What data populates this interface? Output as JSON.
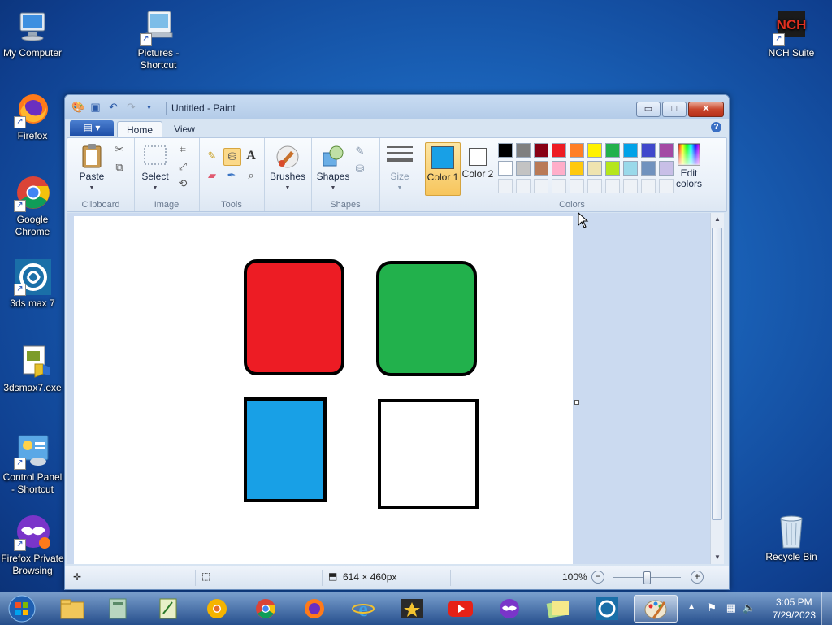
{
  "desktop": {
    "icons": [
      {
        "label": "My Computer",
        "icon": "computer-icon"
      },
      {
        "label": "Pictures - Shortcut",
        "icon": "pictures-shortcut-icon"
      },
      {
        "label": "NCH Suite",
        "icon": "nch-suite-icon"
      },
      {
        "label": "Firefox",
        "icon": "firefox-icon"
      },
      {
        "label": "Google Chrome",
        "icon": "chrome-icon"
      },
      {
        "label": "3ds max 7",
        "icon": "3ds-max-icon"
      },
      {
        "label": "3dsmax7.exe",
        "icon": "setup-exe-icon"
      },
      {
        "label": "Control Panel - Shortcut",
        "icon": "control-panel-icon"
      },
      {
        "label": "Firefox Private Browsing",
        "icon": "firefox-private-icon"
      },
      {
        "label": "Recycle Bin",
        "icon": "recycle-bin-icon"
      }
    ]
  },
  "window": {
    "title": "Untitled - Paint",
    "buttons": {
      "minimize": "▭",
      "maximize": "□",
      "close": "✕"
    }
  },
  "ribbon": {
    "file_label": "▤ ▾",
    "tabs": [
      {
        "label": "Home",
        "active": true
      },
      {
        "label": "View",
        "active": false
      }
    ],
    "groups": {
      "clipboard": {
        "label": "Clipboard",
        "paste": "Paste"
      },
      "image": {
        "label": "Image",
        "select": "Select"
      },
      "tools": {
        "label": "Tools"
      },
      "brushes": {
        "label": "Brushes"
      },
      "shapes": {
        "label": "Shapes",
        "button": "Shapes"
      },
      "size": {
        "label": "Size"
      },
      "colors": {
        "label": "Colors",
        "color1": "Color 1",
        "color2": "Color 2",
        "edit": "Edit colors",
        "color1_value": "#18a0e6",
        "color2_value": "#ffffff",
        "palette_row1": [
          "#000000",
          "#7f7f7f",
          "#880015",
          "#ed1c24",
          "#ff7f27",
          "#fff200",
          "#22b14c",
          "#00a2e8",
          "#3f48cc",
          "#a349a4"
        ],
        "palette_row2": [
          "#ffffff",
          "#c3c3c3",
          "#b97a57",
          "#ffaec9",
          "#ffc90e",
          "#efe4b0",
          "#b5e61d",
          "#99d9ea",
          "#7092be",
          "#c8bfe7"
        ]
      }
    }
  },
  "canvas": {
    "shapes": [
      {
        "name": "red-rounded-rectangle",
        "fill": "#ed1c24"
      },
      {
        "name": "green-rounded-rectangle",
        "fill": "#22b14c"
      },
      {
        "name": "blue-rectangle",
        "fill": "#18a0e6"
      },
      {
        "name": "white-rectangle",
        "fill": "#ffffff"
      }
    ]
  },
  "status": {
    "canvas_size": "614 × 460px",
    "zoom": "100%"
  },
  "taskbar": {
    "apps": [
      "start-orb-icon",
      "file-explorer-icon",
      "files-icon",
      "notepad-icon",
      "chrome-canary-icon",
      "chrome-icon",
      "firefox-icon",
      "internet-explorer-icon",
      "movie-maker-icon",
      "youtube-icon",
      "firefox-private-icon",
      "sticky-notes-icon",
      "3ds-max-icon",
      "paint-icon"
    ],
    "time": "3:05 PM",
    "date": "7/29/2023"
  }
}
